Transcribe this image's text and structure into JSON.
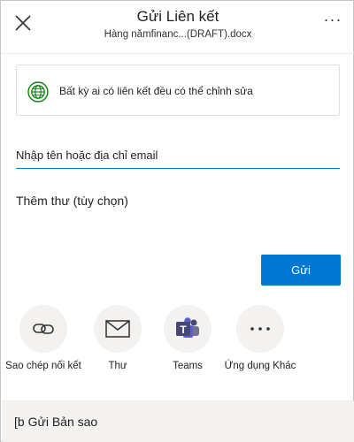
{
  "header": {
    "title": "Gửi Liên kết",
    "subtitle": "Hàng nămfinanc...(DRAFT).docx",
    "more_label": "···"
  },
  "permission": {
    "icon": "globe-icon",
    "text": "Bất kỳ ai có liên kết đều có thể chỉnh sửa"
  },
  "email": {
    "placeholder": "Nhập tên hoặc địa chỉ email",
    "value": ""
  },
  "message": {
    "placeholder": "Thêm thư (tùy chọn)"
  },
  "send_label": "Gửi",
  "share_options": [
    {
      "label": "Sao chép nối kết",
      "icon": "link-icon"
    },
    {
      "label": "Thư",
      "icon": "mail-icon"
    },
    {
      "label": "Teams",
      "icon": "teams-icon"
    },
    {
      "label": "Ứng dụng Khác",
      "icon": "more-apps-icon"
    }
  ],
  "bottom": {
    "label": "[b Gửi Bản sao"
  },
  "colors": {
    "accent": "#0078d4",
    "globe": "#107c10",
    "teams": "#464775"
  }
}
